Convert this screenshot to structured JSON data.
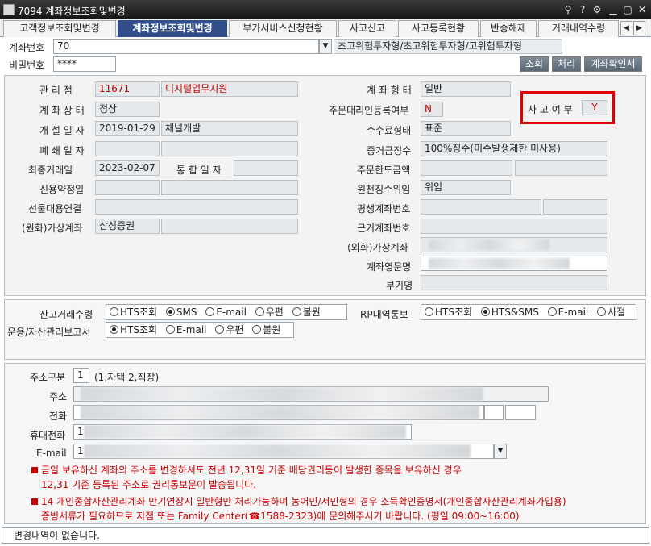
{
  "window": {
    "title": "7094 계좌정보조회및변경"
  },
  "tabs": [
    "고객정보조회및변경",
    "계좌정보조회및변경",
    "부가서비스신청현황",
    "사고신고",
    "사고등록현황",
    "반송해제",
    "거래내역수령"
  ],
  "header": {
    "account_label": "계좌번호",
    "account_value": "70",
    "risk_type": "초고위험투자형/초고위험투자형/고위험투자형",
    "password_label": "비밀번호",
    "password_value": "****",
    "btn_query": "조회",
    "btn_process": "처리",
    "btn_confirm": "계좌확인서"
  },
  "info": {
    "mgmt_label": "관 리 점",
    "mgmt_code": "11671",
    "mgmt_name": "디지털업무지원",
    "status_label": "계 좌 상 태",
    "status_value": "정상",
    "open_label": "개 설 일 자",
    "open_date": "2019-01-29",
    "open_channel": "채널개발",
    "close_label": "폐 쇄 일 자",
    "lasttrade_label": "최종거래일",
    "lasttrade_value": "2023-02-07",
    "merge_label": "통 합 일 자",
    "credit_label": "신용약정일",
    "futures_label": "선물대용연결",
    "virtual_krw_label": "(원화)가상계좌",
    "virtual_krw_value": "삼성증권",
    "form_label": "계 좌 형 태",
    "form_value": "일반",
    "agent_label": "주문대리인등록여부",
    "agent_value": "N",
    "accident_label": "사 고 여 부",
    "accident_value": "Y",
    "fee_label": "수수료형태",
    "fee_value": "표준",
    "deposit_label": "증거금징수",
    "deposit_value": "100%징수(미수발생제한 미사용)",
    "limit_label": "주문한도금액",
    "withhold_label": "원천징수위임",
    "withhold_value": "위임",
    "lifetime_label": "평생계좌번호",
    "basis_label": "근거계좌번호",
    "virtual_fx_label": "(외화)가상계좌",
    "english_label": "계좌영문명",
    "alias_label": "부기명"
  },
  "options": {
    "balance_label": "잔고거래수령",
    "balance_opts": [
      "HTS조회",
      "SMS",
      "E-mail",
      "우편",
      "불원"
    ],
    "balance_selected": "SMS",
    "rp_label": "RP내역통보",
    "rp_opts": [
      "HTS조회",
      "HTS&SMS",
      "E-mail",
      "사절"
    ],
    "rp_selected": "HTS&SMS",
    "report_label": "운용/자산관리보고서",
    "report_opts": [
      "HTS조회",
      "E-mail",
      "우편",
      "불원"
    ],
    "report_selected": "HTS조회"
  },
  "address": {
    "kind_label": "주소구분",
    "kind_value": "1",
    "kind_hint": "(1,자택 2,직장)",
    "addr_label": "주소",
    "phone_label": "전화",
    "mobile_label": "휴대전화",
    "mobile_value": "1",
    "email_label": "E-mail",
    "email_value": "1"
  },
  "notes": [
    "금일 보유하신 계좌의 주소를 변경하셔도 전년 12,31일 기준 배당권리등이 발생한 종목을 보유하신 경우",
    "12,31 기준 등록된 주소로 권리통보문이 발송됩니다.",
    "14 개인종합자산관리계좌 만기연장시 일반형만 처리가능하며 농어민/서민형의 경우 소득확인증명서(개인종합자산관리계좌가입용)",
    "증빙서류가 필요하므로 지점 또는 Family Center(☎1588-2323)에 문의해주시기 바랍니다. (평일 09:00~16:00)"
  ],
  "status": "변경내역이 없습니다.",
  "colors": {
    "highlight": "#e00000",
    "active_tab": "#2f4e8a",
    "alert_text": "#c80000"
  }
}
